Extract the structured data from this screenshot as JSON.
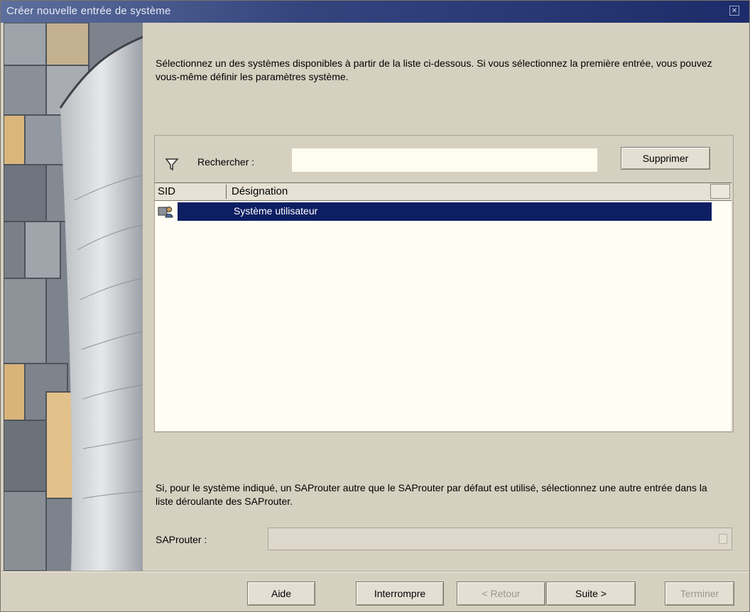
{
  "window": {
    "title": "Créer nouvelle entrée de système",
    "close_glyph": "✕"
  },
  "intro": {
    "text": "Sélectionnez un des systèmes disponibles à partir de la liste ci-dessous. Si vous sélectionnez la première entrée, vous pouvez vous-même définir les paramètres système."
  },
  "search": {
    "label": "Rechercher :",
    "value": "",
    "delete_button": "Supprimer",
    "icon": "filter-icon"
  },
  "table": {
    "columns": [
      "SID",
      "Désignation"
    ],
    "rows": [
      {
        "sid": "",
        "designation": "Système utilisateur",
        "selected": true,
        "icon": "user-system-icon"
      }
    ]
  },
  "saprouter": {
    "text": "Si, pour le système indiqué, un SAProuter autre que le SAProuter par défaut est utilisé, sélectionnez une autre entrée dans la liste déroulante des SAProuter.",
    "label": "SAProuter :",
    "value": ""
  },
  "footer": {
    "help": "Aide",
    "cancel": "Interrompre",
    "back": "< Retour",
    "next": "Suite >",
    "finish": "Terminer"
  },
  "colors": {
    "selection": "#0d1e63",
    "dialog_bg": "#d6d0c0",
    "title_bar": "#1c2c6a"
  }
}
